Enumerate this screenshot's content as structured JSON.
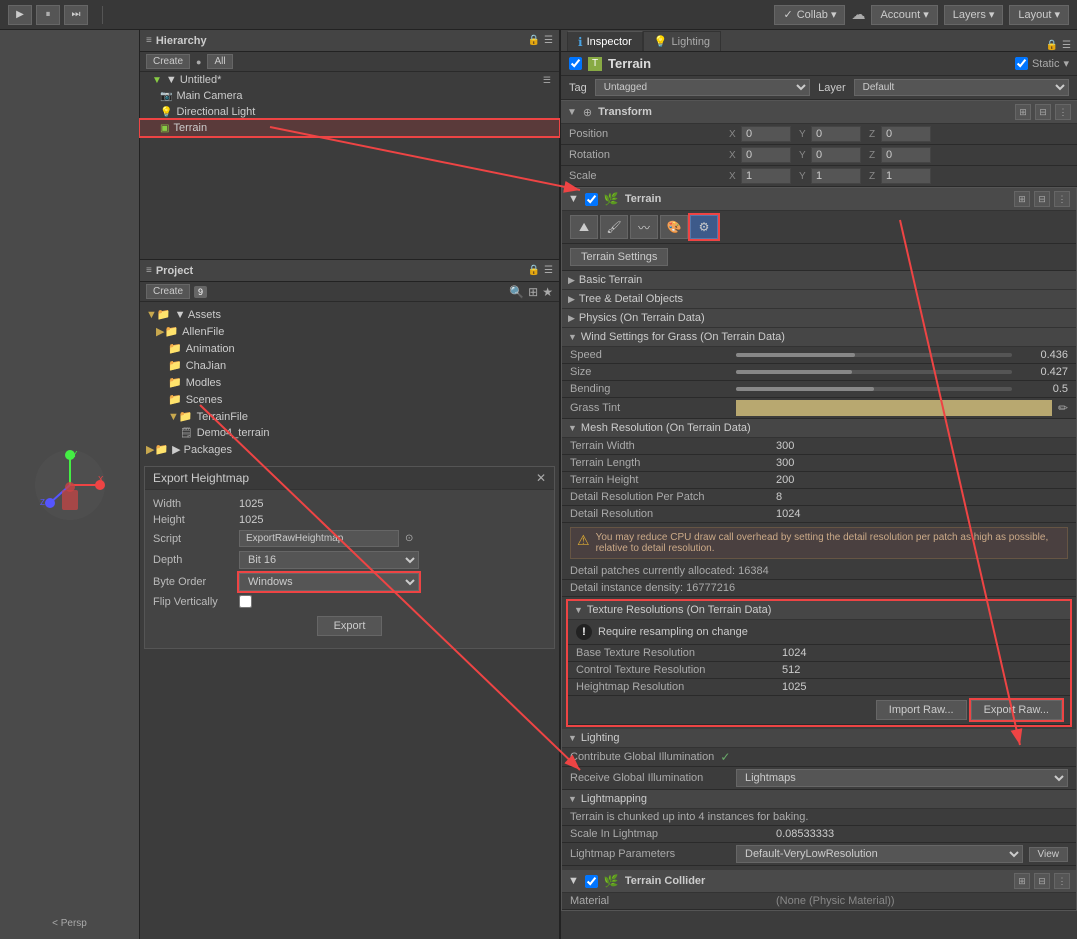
{
  "topbar": {
    "collab_label": "Collab ▾",
    "account_label": "Account ▾",
    "layers_label": "Layers ▾",
    "layout_label": "Layout ▾",
    "cloud_icon": "☁"
  },
  "hierarchy": {
    "title": "Hierarchy",
    "create_label": "Create",
    "all_label": "All",
    "untitled_label": "▼ Untitled*",
    "main_camera": "Main Camera",
    "directional_light": "Directional Light",
    "terrain": "Terrain"
  },
  "project": {
    "title": "Project",
    "create_label": "Create",
    "badge": "9",
    "assets_label": "▼ Assets",
    "allenfile": "AllenFile",
    "animation": "Animation",
    "chajian": "ChaJian",
    "modles": "Modles",
    "scenes": "Scenes",
    "terrainfile": "TerrainFile",
    "demo4": "Demo4_terrain",
    "packages": "▶ Packages"
  },
  "scene": {
    "persp_label": "< Persp"
  },
  "export_popup": {
    "title": "Export Heightmap",
    "width_label": "Width",
    "width_value": "1025",
    "height_label": "Height",
    "height_value": "1025",
    "script_label": "Script",
    "script_value": "ExportRawHeightmap",
    "depth_label": "Depth",
    "depth_value": "Bit 16",
    "byte_order_label": "Byte Order",
    "byte_order_value": "Windows",
    "flip_label": "Flip Vertically",
    "export_btn": "Export"
  },
  "inspector": {
    "title": "Inspector",
    "lighting_tab": "Lighting",
    "object_name": "Terrain",
    "tag_label": "Tag",
    "tag_value": "Untagged",
    "layer_label": "Layer",
    "layer_value": "Default",
    "static_label": "Static",
    "transform_title": "Transform",
    "position_label": "Position",
    "pos_x": "0",
    "pos_y": "0",
    "pos_z": "0",
    "rotation_label": "Rotation",
    "rot_x": "0",
    "rot_y": "0",
    "rot_z": "0",
    "scale_label": "Scale",
    "scale_x": "1",
    "scale_y": "1",
    "scale_z": "1",
    "terrain_component": "Terrain",
    "terrain_settings_btn": "Terrain Settings",
    "basic_terrain": "Basic Terrain",
    "tree_detail": "Tree & Detail Objects",
    "physics": "Physics (On Terrain Data)",
    "wind_settings": "Wind Settings for Grass (On Terrain Data)",
    "speed_label": "Speed",
    "speed_value": "0.436",
    "size_label": "Size",
    "size_value": "0.427",
    "bending_label": "Bending",
    "bending_value": "0.5",
    "grass_tint_label": "Grass Tint",
    "mesh_resolution": "Mesh Resolution (On Terrain Data)",
    "terrain_width_label": "Terrain Width",
    "terrain_width_value": "300",
    "terrain_length_label": "Terrain Length",
    "terrain_length_value": "300",
    "terrain_height_label": "Terrain Height",
    "terrain_height_value": "200",
    "detail_res_patch_label": "Detail Resolution Per Patch",
    "detail_res_patch_value": "8",
    "detail_res_label": "Detail Resolution",
    "detail_res_value": "1024",
    "warning_text": "You may reduce CPU draw call overhead by setting the detail resolution per patch as high as possible, relative to detail resolution.",
    "detail_patches": "Detail patches currently allocated: 16384",
    "detail_instance": "Detail instance density: 16777216",
    "texture_res_section": "Texture Resolutions (On Terrain Data)",
    "require_resampling": "Require resampling on change",
    "base_texture_label": "Base Texture Resolution",
    "base_texture_value": "1024",
    "control_texture_label": "Control Texture Resolution",
    "control_texture_value": "512",
    "heightmap_res_label": "Heightmap Resolution",
    "heightmap_res_value": "1025",
    "import_raw_btn": "Import Raw...",
    "export_raw_btn": "Export Raw...",
    "lighting_section": "Lighting",
    "global_illum_label": "Contribute Global Illumination",
    "receive_illum_label": "Receive Global Illumination",
    "receive_illum_value": "Lightmaps",
    "lightmapping_section": "Lightmapping",
    "lightmap_info": "Terrain is chunked up into 4 instances for baking.",
    "scale_lightmap_label": "Scale In Lightmap",
    "scale_lightmap_value": "0.08533333",
    "lightmap_params_label": "Lightmap Parameters",
    "lightmap_params_value": "Default-VeryLowResolution",
    "view_btn": "View",
    "terrain_collider": "Terrain Collider",
    "material_label": "Material"
  }
}
